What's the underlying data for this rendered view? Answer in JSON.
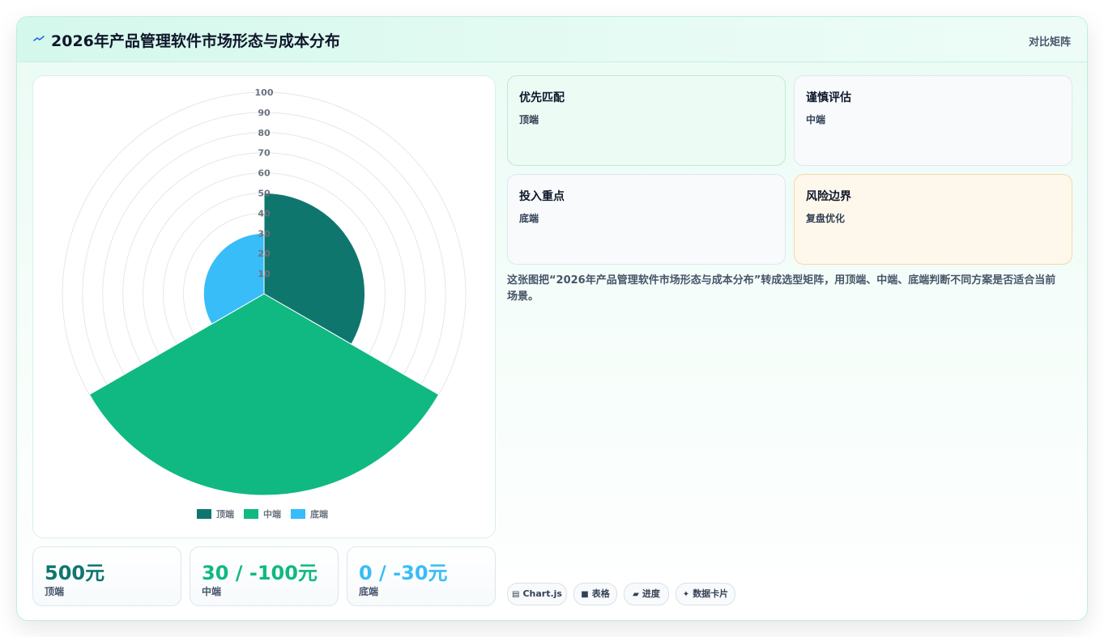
{
  "header": {
    "title": "2026年产品管理软件市场形态与成本分布",
    "right_label": "对比矩阵"
  },
  "colors": {
    "top": "#0f766e",
    "mid": "#10b981",
    "low": "#38bdf8"
  },
  "chart_data": {
    "type": "polarArea",
    "categories": [
      "顶端",
      "中端",
      "底端"
    ],
    "values": [
      50,
      100,
      30
    ],
    "r_range": [
      0,
      100
    ],
    "r_ticks": [
      "10",
      "20",
      "30",
      "40",
      "50",
      "60",
      "70",
      "80",
      "90",
      "100"
    ],
    "legend": [
      "顶端",
      "中端",
      "底端"
    ],
    "legend_position": "bottom"
  },
  "stats": [
    {
      "value": "500元",
      "label": "顶端"
    },
    {
      "value": "30 / -100元",
      "label": "中端"
    },
    {
      "value": "0 / -30元",
      "label": "底端"
    }
  ],
  "boxes": [
    {
      "title": "优先匹配",
      "sub": "顶端"
    },
    {
      "title": "谨慎评估",
      "sub": "中端"
    },
    {
      "title": "投入重点",
      "sub": "底端"
    },
    {
      "title": "风险边界",
      "sub": "复盘优化"
    }
  ],
  "description": "这张图把“2026年产品管理软件市场形态与成本分布”转成选型矩阵，用顶端、中端、底端判断不同方案是否适合当前场景。",
  "tags": [
    {
      "icon": "chart-icon",
      "label": "Chart.js"
    },
    {
      "icon": "table-icon",
      "label": "表格"
    },
    {
      "icon": "progress-icon",
      "label": "进度"
    },
    {
      "icon": "sparkle-icon",
      "label": "数据卡片"
    }
  ]
}
